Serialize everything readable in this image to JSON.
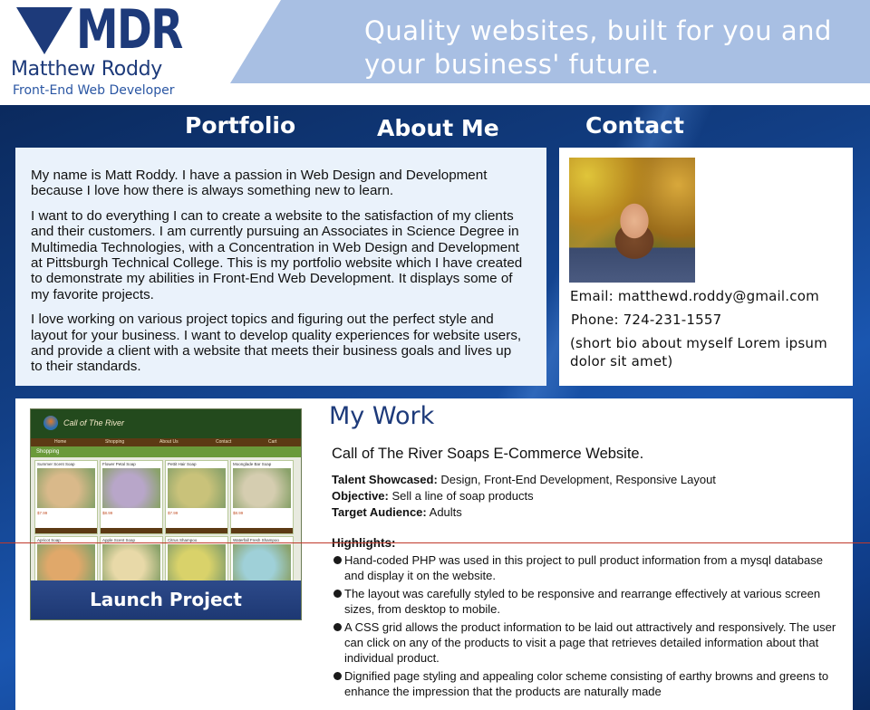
{
  "brand": {
    "logo_text": "MDR",
    "name": "Matthew Roddy",
    "subtitle": "Front-End Web Developer",
    "tagline": "Quality websites, built for you and your business' future."
  },
  "nav": {
    "portfolio": "Portfolio",
    "about": "About Me",
    "contact": "Contact"
  },
  "about": {
    "paragraphs": [
      "My name is Matt Roddy. I have a passion in Web Design and Development because I love how there is always something new to learn.",
      "I want to do everything I can to create a website to the satisfaction of my clients and their customers. I am currently pursuing an Associates in Science Degree in Multimedia Technologies, with a Concentration in Web Design and Development at Pittsburgh Technical College. This is my portfolio website which I have created to demonstrate my abilities in Front-End Web Development. It displays some of my favorite projects.",
      "I love working on various project topics and figuring out the perfect style and layout for your business. I want to develop quality experiences for website users, and provide a client with a website that meets their business goals and lives up to their standards."
    ]
  },
  "contact": {
    "email": "Email: matthewd.roddy@gmail.com",
    "phone": "Phone: 724-231-1557",
    "bio": "(short bio about myself Lorem ipsum dolor sit amet)"
  },
  "work": {
    "heading": "My Work",
    "project_title": "Call of The River Soaps E-Commerce Website.",
    "talent_label": "Talent Showcased:",
    "talent_value": "Design, Front-End Development, Responsive Layout",
    "objective_label": "Objective:",
    "objective_value": "Sell a line of soap products",
    "audience_label": "Target Audience:",
    "audience_value": "Adults",
    "highlights_title": "Highlights:",
    "highlights": [
      "Hand-coded PHP was used in this project to pull product information from a mysql database and display it on the website.",
      "The layout was carefully styled to be responsive and rearrange effectively at various screen sizes, from desktop to mobile.",
      "A CSS grid allows the product information to be laid out attractively and responsively. The user can click on any of the products to visit a page that retrieves detailed information about that individual product.",
      "Dignified page styling and appealing color scheme consisting of earthy browns and greens to enhance the impression that the products are naturally made"
    ],
    "launch_label": "Launch Project"
  },
  "thumbnail": {
    "site_title": "Call of The River",
    "nav": [
      "Home",
      "Shopping",
      "About Us",
      "Contact",
      "Cart"
    ],
    "band": "Shopping",
    "cards": [
      {
        "name": "Summer Scent Soap",
        "price": "$7.99",
        "color": "#d9b98a"
      },
      {
        "name": "Flower Petal Soap",
        "price": "$8.99",
        "color": "#b8a6c9"
      },
      {
        "name": "Pettit Hair Soap",
        "price": "$7.99",
        "color": "#c9c27a"
      },
      {
        "name": "Moonglade Bar Soap",
        "price": "$8.99",
        "color": "#d5cdb0"
      },
      {
        "name": "Apricot Soap",
        "price": "",
        "color": "#e0a86a"
      },
      {
        "name": "Apple Scent Soap",
        "price": "",
        "color": "#e8d9a8"
      },
      {
        "name": "Citrus Shampoo",
        "price": "",
        "color": "#d9d26a"
      },
      {
        "name": "Waterfall Fresh Shampoo",
        "price": "",
        "color": "#9fd0d8"
      }
    ]
  }
}
